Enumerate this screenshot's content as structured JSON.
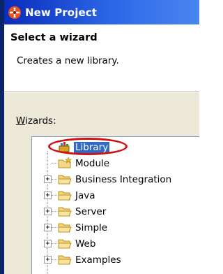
{
  "window": {
    "title": "New Project",
    "title_icon": "new-project-icon"
  },
  "banner": {
    "title": "Select a wizard",
    "description": "Creates a new library."
  },
  "wizards": {
    "label_prefix": "W",
    "label_rest": "izards:",
    "items": [
      {
        "label": "Library",
        "icon": "library-icon",
        "expandable": false,
        "selected": true
      },
      {
        "label": "Module",
        "icon": "new-folder-icon",
        "expandable": false,
        "selected": false
      },
      {
        "label": "Business Integration",
        "icon": "folder-icon",
        "expandable": true,
        "selected": false
      },
      {
        "label": "Java",
        "icon": "folder-icon",
        "expandable": true,
        "selected": false
      },
      {
        "label": "Server",
        "icon": "folder-icon",
        "expandable": true,
        "selected": false
      },
      {
        "label": "Simple",
        "icon": "folder-icon",
        "expandable": true,
        "selected": false
      },
      {
        "label": "Web",
        "icon": "folder-icon",
        "expandable": true,
        "selected": false
      },
      {
        "label": "Examples",
        "icon": "folder-icon",
        "expandable": true,
        "selected": false
      }
    ]
  },
  "colors": {
    "titlebar_start": "#0a2dbc",
    "selection": "#316ac5",
    "annotation_circle": "#d01010"
  }
}
